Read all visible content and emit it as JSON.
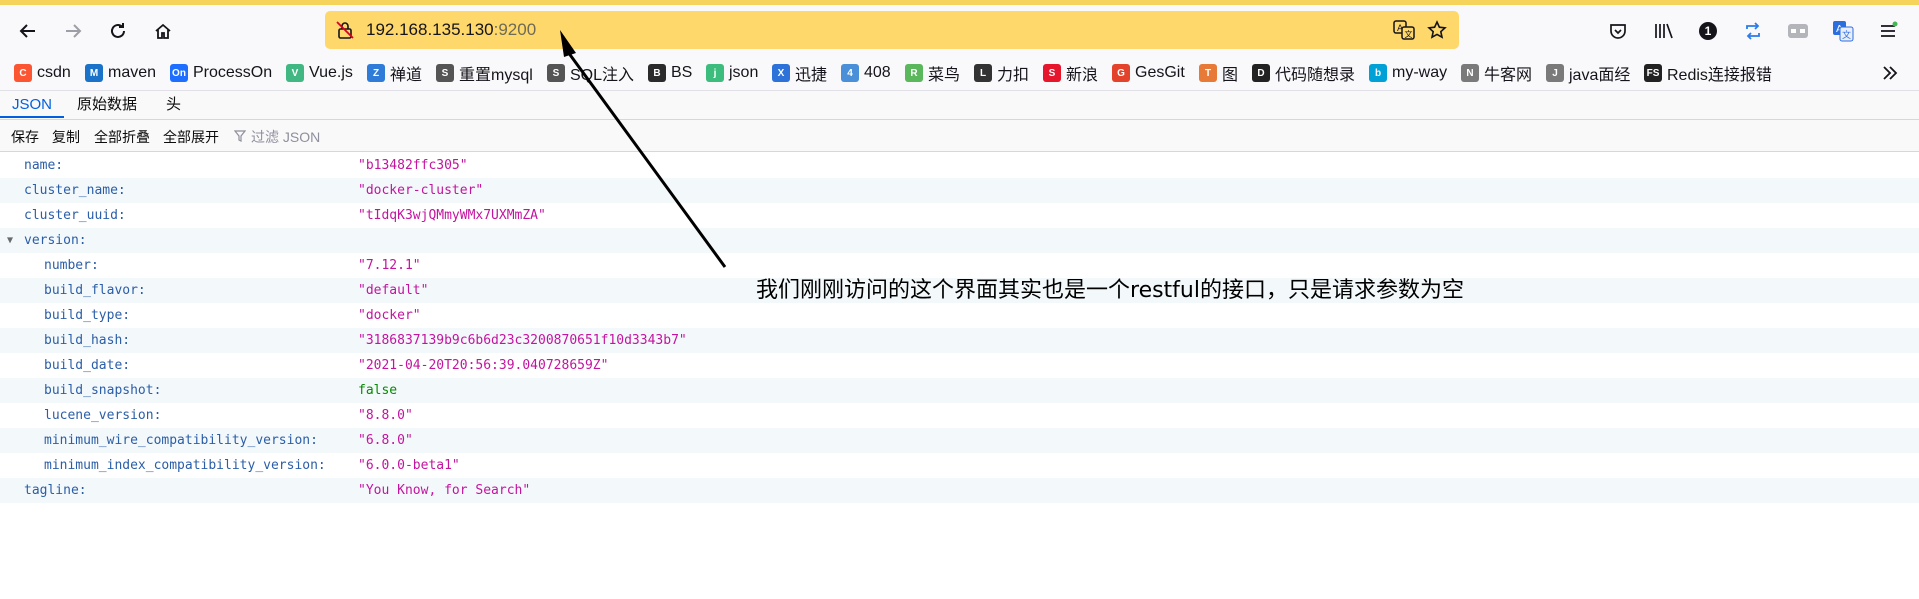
{
  "address_bar": {
    "host": "192.168.135.130",
    "port": ":9200"
  },
  "bookmarks": [
    {
      "label": "csdn",
      "color": "#fc5531",
      "glyph": "C"
    },
    {
      "label": "maven",
      "color": "#1a73c8",
      "glyph": "M"
    },
    {
      "label": "ProcessOn",
      "color": "#1e6fff",
      "glyph": "On"
    },
    {
      "label": "Vue.js",
      "color": "#41b883",
      "glyph": "V"
    },
    {
      "label": "禅道",
      "color": "#2e7bd8",
      "glyph": "Z"
    },
    {
      "label": "重置mysql",
      "color": "#555555",
      "glyph": "S"
    },
    {
      "label": "SQL注入",
      "color": "#555555",
      "glyph": "S"
    },
    {
      "label": "BS",
      "color": "#2b2b2b",
      "glyph": "B"
    },
    {
      "label": "json",
      "color": "#3dbd7d",
      "glyph": "j"
    },
    {
      "label": "迅捷",
      "color": "#2d72d9",
      "glyph": "X"
    },
    {
      "label": "408",
      "color": "#4a90d9",
      "glyph": "4"
    },
    {
      "label": "菜鸟",
      "color": "#5bb75b",
      "glyph": "R"
    },
    {
      "label": "力扣",
      "color": "#333333",
      "glyph": "L"
    },
    {
      "label": "新浪",
      "color": "#e6162d",
      "glyph": "S"
    },
    {
      "label": "GesGit",
      "color": "#e2432a",
      "glyph": "G"
    },
    {
      "label": "图",
      "color": "#e67a36",
      "glyph": "T"
    },
    {
      "label": "代码随想录",
      "color": "#222222",
      "glyph": "D"
    },
    {
      "label": "my-way",
      "color": "#00a1d6",
      "glyph": "b"
    },
    {
      "label": "牛客网",
      "color": "#7a7a7a",
      "glyph": "N"
    },
    {
      "label": "java面经",
      "color": "#7a7a7a",
      "glyph": "J"
    },
    {
      "label": "Redis连接报错",
      "color": "#222222",
      "glyph": "FS"
    }
  ],
  "viewer_tabs": {
    "json": "JSON",
    "raw": "原始数据",
    "headers": "头"
  },
  "toolbar": {
    "save": "保存",
    "copy": "复制",
    "collapse_all": "全部折叠",
    "expand_all": "全部展开",
    "filter_placeholder": "过滤 JSON"
  },
  "json_rows": [
    {
      "key": "name:",
      "value": "\"b13482ffc305\"",
      "type": "string",
      "indent": 0
    },
    {
      "key": "cluster_name:",
      "value": "\"docker-cluster\"",
      "type": "string",
      "indent": 0
    },
    {
      "key": "cluster_uuid:",
      "value": "\"tIdqK3wjQMmyWMx7UXMmZA\"",
      "type": "string",
      "indent": 0
    },
    {
      "key": "version:",
      "value": "",
      "type": "object",
      "indent": 0
    },
    {
      "key": "number:",
      "value": "\"7.12.1\"",
      "type": "string",
      "indent": 1
    },
    {
      "key": "build_flavor:",
      "value": "\"default\"",
      "type": "string",
      "indent": 1
    },
    {
      "key": "build_type:",
      "value": "\"docker\"",
      "type": "string",
      "indent": 1
    },
    {
      "key": "build_hash:",
      "value": "\"3186837139b9c6b6d23c3200870651f10d3343b7\"",
      "type": "string",
      "indent": 1
    },
    {
      "key": "build_date:",
      "value": "\"2021-04-20T20:56:39.040728659Z\"",
      "type": "string",
      "indent": 1
    },
    {
      "key": "build_snapshot:",
      "value": "false",
      "type": "bool",
      "indent": 1
    },
    {
      "key": "lucene_version:",
      "value": "\"8.8.0\"",
      "type": "string",
      "indent": 1
    },
    {
      "key": "minimum_wire_compatibility_version:",
      "value": "\"6.8.0\"",
      "type": "string",
      "indent": 1
    },
    {
      "key": "minimum_index_compatibility_version:",
      "value": "\"6.0.0-beta1\"",
      "type": "string",
      "indent": 1
    },
    {
      "key": "tagline:",
      "value": "\"You Know, for Search\"",
      "type": "string",
      "indent": 0
    }
  ],
  "annotation_text": "我们刚刚访问的这个界面其实也是一个restful的接口，只是请求参数为空",
  "notification_count": "1",
  "colors": {
    "url_bar": "#ffd86b",
    "key": "#2b5ea7",
    "string": "#c3149f",
    "bool": "#058b00",
    "active_tab": "#0060df"
  },
  "icons": [
    "back-icon",
    "forward-icon",
    "reload-icon",
    "home-icon",
    "lock-warning-icon",
    "translate-icon",
    "star-icon",
    "pocket-icon",
    "library-icon",
    "sync-icon",
    "container-icon",
    "translate-ext-icon",
    "menu-icon",
    "twisty-icon",
    "filter-icon",
    "more-bookmarks-icon"
  ]
}
